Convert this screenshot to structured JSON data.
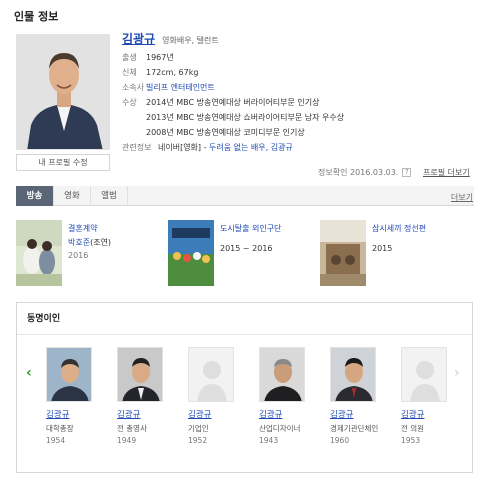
{
  "section_title": "인물 정보",
  "profile": {
    "name": "김광규",
    "job": "영화배우, 탤런트",
    "edit_label": "내 프로필 수정",
    "rows": {
      "birth": {
        "label": "출생",
        "value": "1967년"
      },
      "body": {
        "label": "신체",
        "value": "172cm, 67kg"
      },
      "agency": {
        "label": "소속사",
        "value": "빌리프 엔터테인먼트"
      },
      "awards_label": "수상",
      "awards": [
        "2014년 MBC 방송연예대상 버라이어티부문 인기상",
        "2013년 MBC 방송연예대상 쇼버라이어티부문 남자 우수상",
        "2008년 MBC 방송연예대상 코미디부문 인기상"
      ],
      "related": {
        "label": "관련정보",
        "prefix": "네이버[영화] - ",
        "link": "두려움 없는 배우, 김광규"
      }
    },
    "check_date": "정보확인 2016.03.03.",
    "check_q": "?",
    "more_label": "프로필 더보기"
  },
  "tabs": {
    "items": [
      "방송",
      "영화",
      "앨범"
    ],
    "active": "방송",
    "more_label": "더보기"
  },
  "works": [
    {
      "title": "결혼계약",
      "role_name": "박호준",
      "role_suffix": "(조연)",
      "year": "2016"
    },
    {
      "title": "도시탈출 외인구단",
      "role_name": "",
      "role_suffix": "",
      "year": "2015 ~ 2016"
    },
    {
      "title": "삼시세끼 정선편",
      "role_name": "",
      "role_suffix": "",
      "year": "2015"
    }
  ],
  "same_name": {
    "title": "동명이인",
    "people": [
      {
        "name": "김광규",
        "job": "대학총장",
        "year": "1954"
      },
      {
        "name": "김광규",
        "job": "전 총영사",
        "year": "1949"
      },
      {
        "name": "김광규",
        "job": "기업인",
        "year": "1952"
      },
      {
        "name": "김광규",
        "job": "산업디자이너",
        "year": "1943"
      },
      {
        "name": "김광규",
        "job": "경제기관단체인",
        "year": "1960"
      },
      {
        "name": "김광규",
        "job": "전 의원",
        "year": "1953"
      }
    ]
  },
  "colors": {
    "link": "#1e49b7",
    "active_tab": "#5a6576",
    "arrow": "#27a030"
  }
}
